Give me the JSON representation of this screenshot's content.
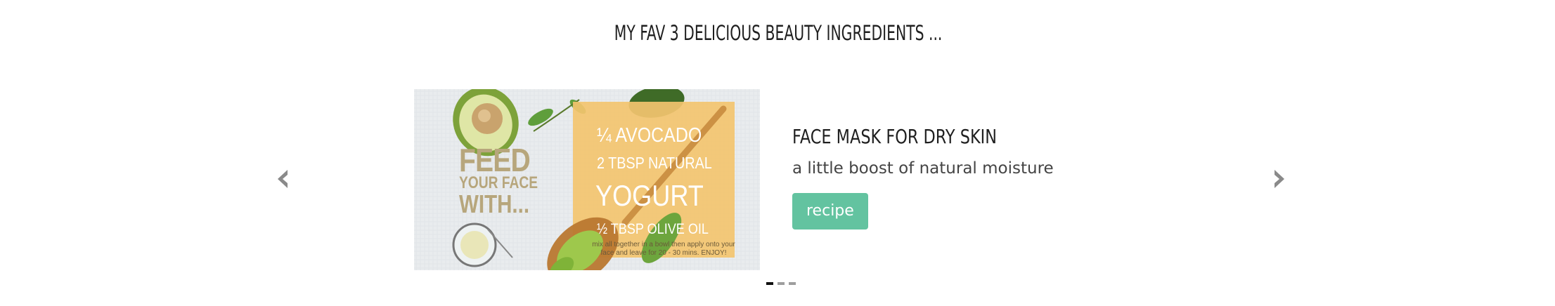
{
  "section": {
    "title": "MY FAV 3 DELICIOUS BEAUTY INGREDIENTS ..."
  },
  "carousel": {
    "prev_icon": "chevron-left-icon",
    "next_icon": "chevron-right-icon",
    "active_index": 0,
    "indicator_count": 3,
    "slide": {
      "image_text": {
        "feed_line1": "FEED",
        "feed_line2": "YOUR FACE",
        "feed_line3": "WITH...",
        "avocado": "¼ AVOCADO",
        "yogurt_amount": "2 TBSP NATURAL",
        "yogurt": "YOGURT",
        "olive_oil": "½ TBSP OLIVE OIL",
        "instructions": "mix all together in a bowl then apply onto your face and leave for 20 - 30 mins. ENJOY!"
      },
      "title": "FACE MASK FOR DRY SKIN",
      "subtitle": "a little boost of natural moisture",
      "button_label": "recipe"
    }
  },
  "colors": {
    "accent": "#63c3a0",
    "card": "#f3c46f",
    "title_text": "#1f1f1f",
    "arrow": "#8a8a8a"
  }
}
